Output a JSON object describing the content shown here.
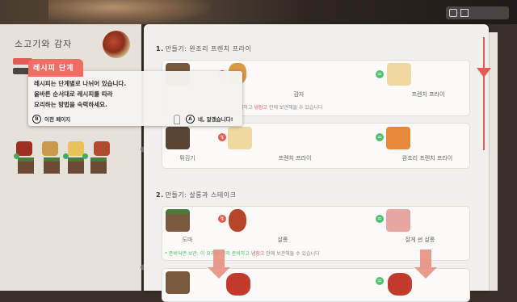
{
  "left_panel": {
    "title": "소고기와 감자"
  },
  "tooltip": {
    "header": "레시피 단계",
    "lines": [
      "레시피는 단계별로 나뉘어 있습니다.",
      "올바른 순서대로 레시피를 따라",
      "요리하는 방법을 숙력하세요."
    ],
    "back_key": "B",
    "back_label": "이전 페이지",
    "confirm_key": "A",
    "confirm_label": "네, 알겠습니다!"
  },
  "sections": [
    {
      "title_num": "1.",
      "title": "만들기: 완조리 프렌치 프라이",
      "rows": [
        {
          "slots": [
            "",
            "감자",
            "프렌치 프라이"
          ],
          "note_pre": "비하고 ",
          "note_accent": "냉장고",
          "note_post": " 안에 보관해둘 수 있습니다"
        },
        {
          "slots": [
            "튀김기",
            "프렌치 프라이",
            "완조리 프렌치 프라이"
          ]
        }
      ]
    },
    {
      "title_num": "2.",
      "title": "만들기: 살롱과 스테이크",
      "rows": [
        {
          "slots": [
            "도마",
            "살롱",
            "잘게 썬 살롱"
          ],
          "note_pre": "* 준비되면 보관: 이 요리를 먼저 준비하고 ",
          "note_accent": "냉장고",
          "note_post": " 안에 보관해둘 수 있습니다"
        }
      ]
    }
  ],
  "badges": {
    "red": "↯",
    "green": "="
  },
  "colors": {
    "accent": "#ef6d62",
    "green": "#52c06f",
    "card": "#f2f0ec"
  }
}
